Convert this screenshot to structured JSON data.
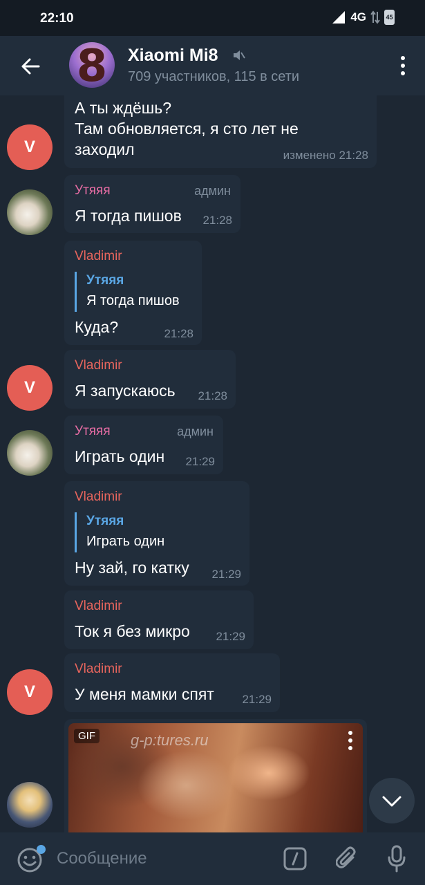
{
  "status_bar": {
    "time": "22:10",
    "network": "4G",
    "battery": "45"
  },
  "header": {
    "avatar_glyph": "8",
    "title": "Xiaomi Mi8",
    "subtitle": "709 участников, 115 в сети"
  },
  "colors": {
    "vladimir": "#e8655d",
    "utyaya": "#e56ca3",
    "reply_accent": "#5aa6e4",
    "bubble": "#212d3b",
    "background": "#1d2733"
  },
  "messages": [
    {
      "line1": "А ты ждёшь?",
      "line2": "Там обновляется, я сто лет не",
      "line3": "заходил",
      "time": "изменено 21:28"
    },
    {
      "sender": "Утяяя",
      "role": "админ",
      "text": "Я тогда пишов",
      "time": "21:28"
    },
    {
      "sender": "Vladimir",
      "reply_name": "Утяяя",
      "reply_text": "Я тогда пишов",
      "text": "Куда?",
      "time": "21:28"
    },
    {
      "sender": "Vladimir",
      "text": "Я запускаюсь",
      "time": "21:28"
    },
    {
      "sender": "Утяяя",
      "role": "админ",
      "text": "Играть один",
      "time": "21:29"
    },
    {
      "sender": "Vladimir",
      "reply_name": "Утяяя",
      "reply_text": "Играть один",
      "text": "Ну зай, го катку",
      "time": "21:29"
    },
    {
      "sender": "Vladimir",
      "text": "Ток я без микро",
      "time": "21:29"
    },
    {
      "sender": "Vladimir",
      "text": "У меня мамки спят",
      "time": "21:29"
    },
    {
      "media_badge": "GIF",
      "watermark": "g-p:tures.ru"
    }
  ],
  "avatar_letter": "V",
  "input": {
    "placeholder": "Сообщение"
  },
  "icons": [
    "back-arrow-icon",
    "mute-icon",
    "more-vert-icon",
    "chevron-down-icon",
    "emoji-icon",
    "bot-command-icon",
    "paperclip-icon",
    "microphone-icon"
  ]
}
